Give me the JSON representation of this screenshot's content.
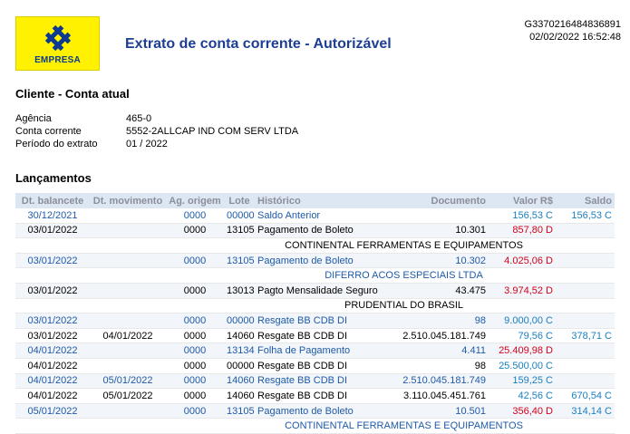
{
  "header": {
    "logo_text": "EMPRESA",
    "title": "Extrato de conta corrente - Autorizável",
    "doc_id": "G3370216484836891",
    "datetime": "02/02/2022 16:52:48"
  },
  "client": {
    "section_title": "Cliente - Conta atual",
    "fields": [
      {
        "label": "Agência",
        "value": "465-0"
      },
      {
        "label": "Conta corrente",
        "value": "5552-2ALLCAP IND COM SERV LTDA"
      },
      {
        "label": "Período do extrato",
        "value": "01 / 2022"
      }
    ]
  },
  "ledger": {
    "section_title": "Lançamentos",
    "columns": [
      "Dt. balancete",
      "Dt. movimento",
      "Ag. origem",
      "Lote",
      "Histórico",
      "Documento",
      "Valor R$",
      "Saldo"
    ],
    "rows": [
      {
        "kind": "entry",
        "dt_bal": "30/12/2021",
        "dt_mov": "",
        "ag": "0000",
        "lote": "00000",
        "hist": "Saldo Anterior",
        "doc": "",
        "valor": "156,53 C",
        "saldo": "156,53 C",
        "sign": "credit",
        "blue": true
      },
      {
        "kind": "entry",
        "dt_bal": "03/01/2022",
        "dt_mov": "",
        "ag": "0000",
        "lote": "13105",
        "hist": "Pagamento de Boleto",
        "doc": "10.301",
        "valor": "857,80 D",
        "saldo": "",
        "sign": "debit",
        "blue": false
      },
      {
        "kind": "note",
        "text": "CONTINENTAL FERRAMENTAS E EQUIPAMENTOS",
        "blue": false
      },
      {
        "kind": "entry",
        "dt_bal": "03/01/2022",
        "dt_mov": "",
        "ag": "0000",
        "lote": "13105",
        "hist": "Pagamento de Boleto",
        "doc": "10.302",
        "valor": "4.025,06 D",
        "saldo": "",
        "sign": "debit",
        "blue": true
      },
      {
        "kind": "note",
        "text": "DIFERRO ACOS ESPECIAIS LTDA",
        "blue": true
      },
      {
        "kind": "entry",
        "dt_bal": "03/01/2022",
        "dt_mov": "",
        "ag": "0000",
        "lote": "13013",
        "hist": "Pagto Mensalidade Seguro",
        "doc": "43.475",
        "valor": "3.974,52 D",
        "saldo": "",
        "sign": "debit",
        "blue": false
      },
      {
        "kind": "note",
        "text": "PRUDENTIAL DO BRASIL",
        "blue": false
      },
      {
        "kind": "entry",
        "dt_bal": "03/01/2022",
        "dt_mov": "",
        "ag": "0000",
        "lote": "00000",
        "hist": "Resgate BB CDB DI",
        "doc": "98",
        "valor": "9.000,00 C",
        "saldo": "",
        "sign": "credit",
        "blue": true
      },
      {
        "kind": "entry",
        "dt_bal": "03/01/2022",
        "dt_mov": "04/01/2022",
        "ag": "0000",
        "lote": "14060",
        "hist": "Resgate BB CDB DI",
        "doc": "2.510.045.181.749",
        "valor": "79,56 C",
        "saldo": "378,71 C",
        "sign": "credit",
        "blue": false
      },
      {
        "kind": "entry",
        "dt_bal": "04/01/2022",
        "dt_mov": "",
        "ag": "0000",
        "lote": "13134",
        "hist": "Folha de Pagamento",
        "doc": "4.411",
        "valor": "25.409,98 D",
        "saldo": "",
        "sign": "debit",
        "blue": true
      },
      {
        "kind": "entry",
        "dt_bal": "04/01/2022",
        "dt_mov": "",
        "ag": "0000",
        "lote": "00000",
        "hist": "Resgate BB CDB DI",
        "doc": "98",
        "valor": "25.500,00 C",
        "saldo": "",
        "sign": "credit",
        "blue": false
      },
      {
        "kind": "entry",
        "dt_bal": "04/01/2022",
        "dt_mov": "05/01/2022",
        "ag": "0000",
        "lote": "14060",
        "hist": "Resgate BB CDB DI",
        "doc": "2.510.045.181.749",
        "valor": "159,25 C",
        "saldo": "",
        "sign": "credit",
        "blue": true
      },
      {
        "kind": "entry",
        "dt_bal": "04/01/2022",
        "dt_mov": "05/01/2022",
        "ag": "0000",
        "lote": "14060",
        "hist": "Resgate BB CDB DI",
        "doc": "3.110.045.451.761",
        "valor": "42,56 C",
        "saldo": "670,54 C",
        "sign": "credit",
        "blue": false
      },
      {
        "kind": "entry",
        "dt_bal": "05/01/2022",
        "dt_mov": "",
        "ag": "0000",
        "lote": "13105",
        "hist": "Pagamento de Boleto",
        "doc": "10.501",
        "valor": "356,40 D",
        "saldo": "314,14 C",
        "sign": "debit",
        "blue": true
      },
      {
        "kind": "note",
        "text": "CONTINENTAL FERRAMENTAS E EQUIPAMENTOS",
        "blue": true
      }
    ]
  },
  "colors": {
    "title_blue": "#1c3f94",
    "header_bg": "#dde6f3",
    "credit": "#1a7fc0",
    "debit": "#d0021b",
    "logo_yellow": "#fff100"
  }
}
